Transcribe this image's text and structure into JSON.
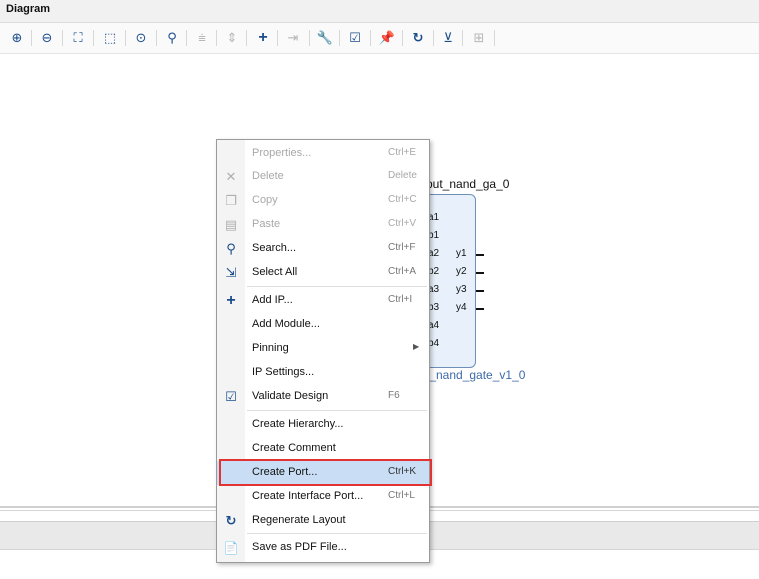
{
  "panel": {
    "title": "Diagram"
  },
  "toolbar": {
    "icons": [
      "zoom-in-icon",
      "zoom-out-icon",
      "fit-view-icon",
      "zoom-selection-icon",
      "auto-fit-icon",
      "search-icon",
      "collapse-icon",
      "expand-icon",
      "add-ip-icon",
      "add-port-icon",
      "wrench-icon",
      "validate-icon",
      "pin-icon",
      "regenerate-icon",
      "layout-icon",
      "collapse-all-icon"
    ]
  },
  "block": {
    "title": "put_nand_ga_0",
    "subtitle": "t_nand_gate_v1_0",
    "inputs": [
      "a1",
      "b1",
      "a2",
      "b2",
      "a3",
      "b3",
      "a4",
      "b4"
    ],
    "outputs": [
      "y1",
      "y2",
      "y3",
      "y4"
    ]
  },
  "menu": {
    "items": [
      {
        "label": "Properties...",
        "shortcut": "Ctrl+E",
        "disabled": true,
        "icon": ""
      },
      {
        "label": "Delete",
        "shortcut": "Delete",
        "disabled": true,
        "icon": "✕"
      },
      {
        "label": "Copy",
        "shortcut": "Ctrl+C",
        "disabled": true,
        "icon": "❐"
      },
      {
        "label": "Paste",
        "shortcut": "Ctrl+V",
        "disabled": true,
        "icon": "▤"
      },
      {
        "label": "Search...",
        "shortcut": "Ctrl+F",
        "disabled": false,
        "icon": "⚲"
      },
      {
        "label": "Select All",
        "shortcut": "Ctrl+A",
        "disabled": false,
        "icon": "⇲"
      },
      {
        "label": "Add IP...",
        "shortcut": "Ctrl+I",
        "disabled": false,
        "icon": "+"
      },
      {
        "label": "Add Module...",
        "shortcut": "",
        "disabled": false,
        "icon": ""
      },
      {
        "label": "Pinning",
        "shortcut": "",
        "disabled": false,
        "icon": "",
        "submenu": true
      },
      {
        "label": "IP Settings...",
        "shortcut": "",
        "disabled": false,
        "icon": ""
      },
      {
        "label": "Validate Design",
        "shortcut": "F6",
        "disabled": false,
        "icon": "☑"
      },
      {
        "label": "Create Hierarchy...",
        "shortcut": "",
        "disabled": false,
        "icon": ""
      },
      {
        "label": "Create Comment",
        "shortcut": "",
        "disabled": false,
        "icon": ""
      },
      {
        "label": "Create Port...",
        "shortcut": "Ctrl+K",
        "disabled": false,
        "icon": "",
        "highlighted": true
      },
      {
        "label": "Create Interface Port...",
        "shortcut": "Ctrl+L",
        "disabled": false,
        "icon": ""
      },
      {
        "label": "Regenerate Layout",
        "shortcut": "",
        "disabled": false,
        "icon": "↻"
      },
      {
        "label": "Save as PDF File...",
        "shortcut": "",
        "disabled": false,
        "icon": "📄"
      }
    ]
  }
}
